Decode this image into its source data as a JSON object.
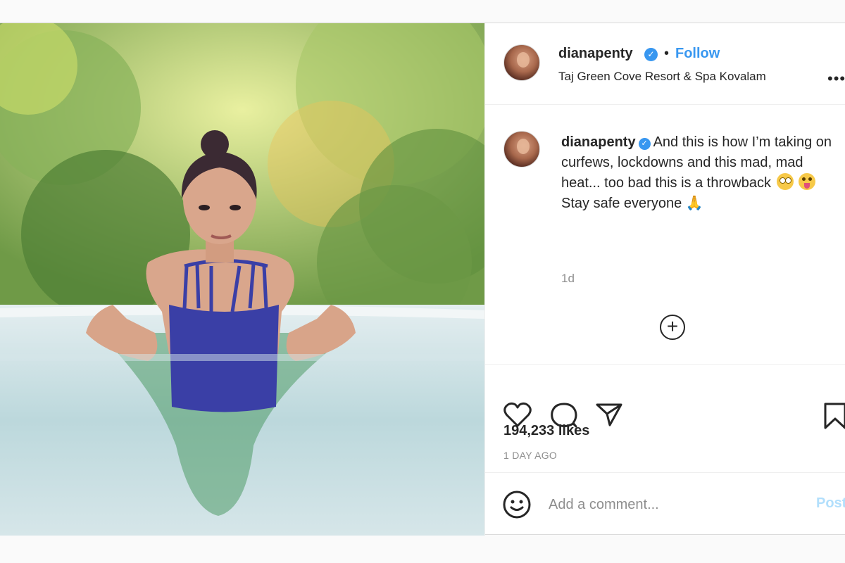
{
  "post": {
    "username": "dianapenty",
    "verified_mark": "✓",
    "separator": "•",
    "follow_label": "Follow",
    "location": "Taj Green Cove Resort & Spa Kovalam",
    "more_icon": "more-options-icon"
  },
  "caption": {
    "username": "dianapenty",
    "text_line1": "And this is how I’m taking on curfews, lockdowns and this mad, mad heat... too bad this is a throwback",
    "text_line2": "Stay safe everyone",
    "time_ago": "1d",
    "emojis": [
      "face-with-rolling-eyes",
      "winking-face-with-tongue",
      "folded-hands"
    ]
  },
  "load_more_label": "+",
  "actions": {
    "icons": [
      "heart-icon",
      "comment-icon",
      "share-icon",
      "bookmark-icon"
    ],
    "likes": "194,233 likes",
    "date": "1 DAY AGO"
  },
  "comment_box": {
    "placeholder": "Add a comment...",
    "post_label": "Post"
  },
  "colors": {
    "link_blue": "#3897f0",
    "post_disabled": "#b2dffc",
    "secondary_text": "#8e8e8e",
    "border": "#dbdbdb"
  }
}
